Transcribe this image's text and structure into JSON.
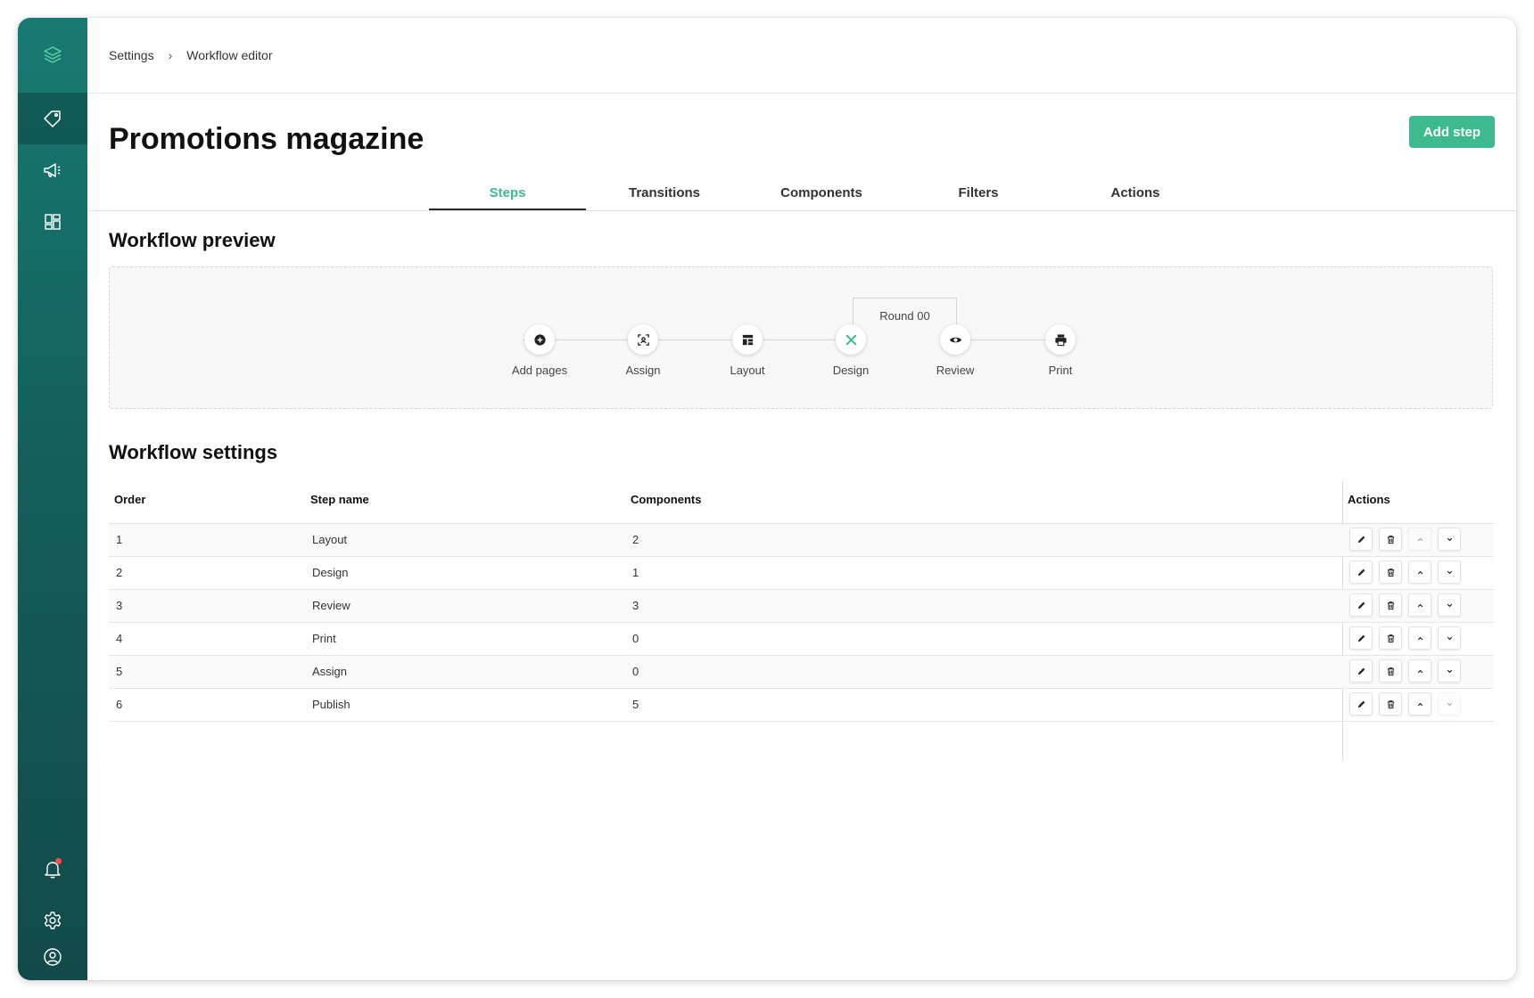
{
  "breadcrumb": {
    "root": "Settings",
    "current": "Workflow editor"
  },
  "page": {
    "title": "Promotions magazine",
    "primary_action": "Add step"
  },
  "tabs": [
    {
      "label": "Steps",
      "active": true
    },
    {
      "label": "Transitions",
      "active": false
    },
    {
      "label": "Components",
      "active": false
    },
    {
      "label": "Filters",
      "active": false
    },
    {
      "label": "Actions",
      "active": false
    }
  ],
  "preview": {
    "title": "Workflow preview",
    "round_label": "Round 00",
    "nodes": [
      {
        "label": "Add pages",
        "icon": "plus-circle-icon"
      },
      {
        "label": "Assign",
        "icon": "scan-icon"
      },
      {
        "label": "Layout",
        "icon": "layout-icon"
      },
      {
        "label": "Design",
        "icon": "design-tools-icon"
      },
      {
        "label": "Review",
        "icon": "eye-icon"
      },
      {
        "label": "Print",
        "icon": "printer-icon"
      }
    ]
  },
  "settings": {
    "title": "Workflow settings",
    "columns": {
      "order": "Order",
      "step_name": "Step name",
      "components": "Components",
      "actions": "Actions"
    },
    "rows": [
      {
        "order": "1",
        "step_name": "Layout",
        "components": "2"
      },
      {
        "order": "2",
        "step_name": "Design",
        "components": "1"
      },
      {
        "order": "3",
        "step_name": "Review",
        "components": "3"
      },
      {
        "order": "4",
        "step_name": "Print",
        "components": "0"
      },
      {
        "order": "5",
        "step_name": "Assign",
        "components": "0"
      },
      {
        "order": "6",
        "step_name": "Publish",
        "components": "5"
      }
    ]
  },
  "colors": {
    "accent": "#3dbb8f",
    "sidebar": "#145f5b",
    "notification": "#ff4b4b"
  }
}
